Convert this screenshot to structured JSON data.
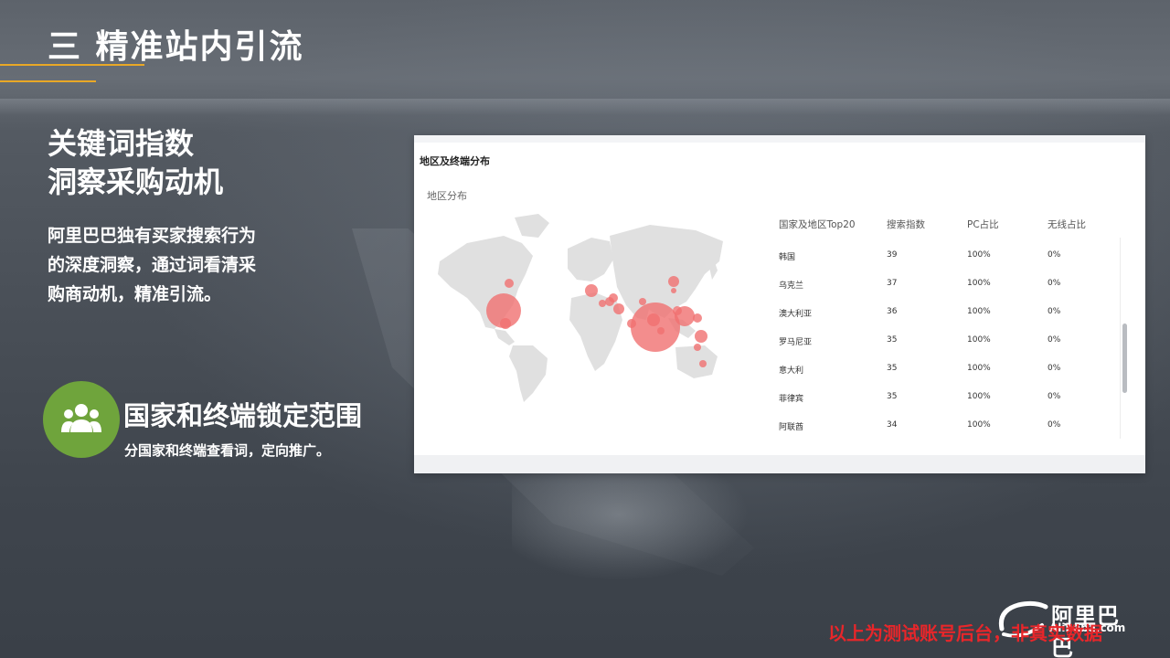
{
  "header": {
    "title": "三 精准站内引流"
  },
  "headline": {
    "line1": "关键词指数",
    "line2": "洞察采购动机"
  },
  "description": {
    "line1": "阿里巴巴独有买家搜索行为",
    "line2": "的深度洞察，通过词看清采",
    "line3": "购商动机，精准引流。"
  },
  "feature": {
    "icon": "users-icon",
    "title": "国家和终端锁定范围",
    "subtitle": "分国家和终端查看词，定向推广。"
  },
  "panel": {
    "title": "地区及终端分布",
    "subtitle": "地区分布",
    "columns": [
      "国家及地区Top20",
      "搜索指数",
      "PC占比",
      "无线占比"
    ],
    "rows": [
      {
        "country": "韩国",
        "index": "39",
        "pc": "100%",
        "mobile": "0%"
      },
      {
        "country": "乌克兰",
        "index": "37",
        "pc": "100%",
        "mobile": "0%"
      },
      {
        "country": "澳大利亚",
        "index": "36",
        "pc": "100%",
        "mobile": "0%"
      },
      {
        "country": "罗马尼亚",
        "index": "35",
        "pc": "100%",
        "mobile": "0%"
      },
      {
        "country": "意大利",
        "index": "35",
        "pc": "100%",
        "mobile": "0%"
      },
      {
        "country": "菲律宾",
        "index": "35",
        "pc": "100%",
        "mobile": "0%"
      },
      {
        "country": "阿联酋",
        "index": "34",
        "pc": "100%",
        "mobile": "0%"
      }
    ],
    "bubble_color": "#f07070",
    "land_color": "#e0e0e0",
    "scroll_position": 0.65
  },
  "logo": {
    "cn": "阿里巴巴",
    "en": "Alibaba.com"
  },
  "disclaimer": "以上为测试账号后台，非真实数据",
  "colors": {
    "accent": "#e9a826",
    "badge": "#6fa43c",
    "warning": "#e8262a"
  }
}
